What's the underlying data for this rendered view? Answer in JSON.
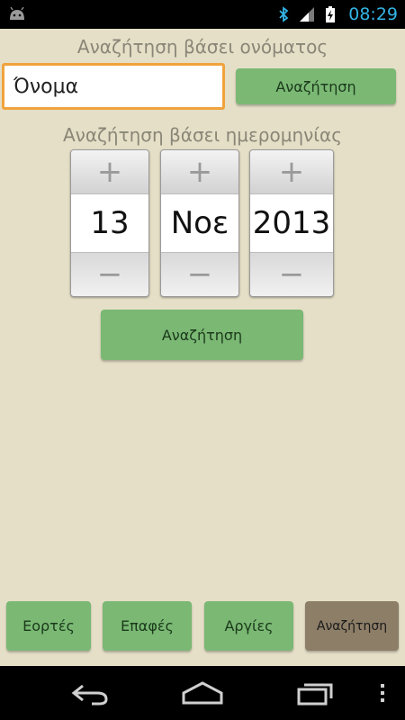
{
  "status": {
    "time": "08:29",
    "icons": [
      "android-icon",
      "bluetooth-icon",
      "signal-icon",
      "battery-charging-icon"
    ]
  },
  "name_search": {
    "title": "Αναζήτηση βάσει ονόματος",
    "input_value": "Όνομα",
    "button_label": "Αναζήτηση"
  },
  "date_search": {
    "title": "Αναζήτηση βάσει ημερομηνίας",
    "day": "13",
    "month": "Νοε",
    "year": "2013",
    "plus": "+",
    "minus": "−",
    "button_label": "Αναζήτηση"
  },
  "tabs": [
    {
      "label": "Εορτές"
    },
    {
      "label": "Επαφές"
    },
    {
      "label": "Αργίες"
    },
    {
      "label": "Αναζήτηση"
    }
  ],
  "colors": {
    "background": "#e5dfc7",
    "accent_green": "#7ab874",
    "selected_tab": "#8d7e68",
    "input_focus": "#f0a33c",
    "status_clock": "#33b5e5"
  },
  "nav": [
    "back-icon",
    "home-icon",
    "recent-apps-icon",
    "menu-icon"
  ]
}
